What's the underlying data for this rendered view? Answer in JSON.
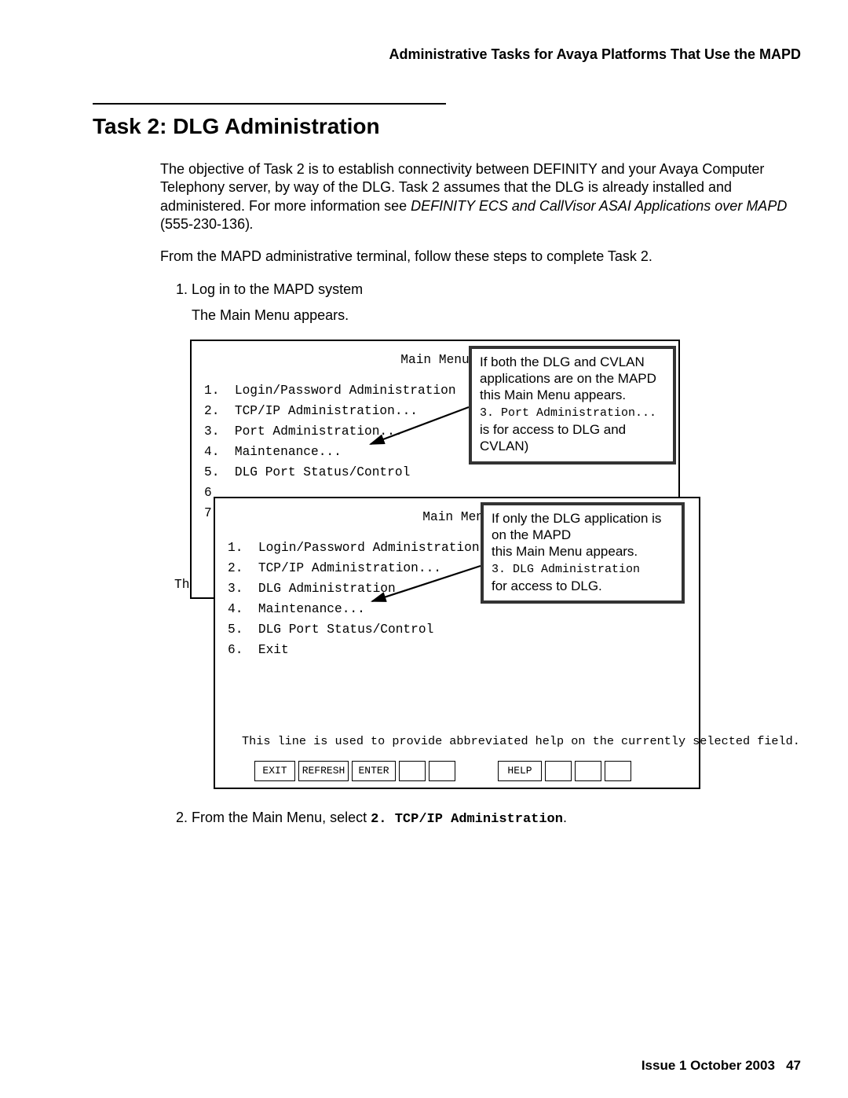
{
  "header": "Administrative Tasks for Avaya Platforms That Use the MAPD",
  "title": "Task 2: DLG Administration",
  "intro": {
    "p1a": "The objective of Task 2 is to establish connectivity between DEFINITY and your Avaya Computer Telephony server, by way of the DLG. Task 2 assumes that the DLG is already installed and administered. For more information see ",
    "p1b": "DEFINITY ECS and CallVisor ASAI Applications over MAPD",
    "p1c": " (555-230-136)",
    "p1d": ".",
    "p2": "From the MAPD administrative terminal, follow these steps to complete Task 2."
  },
  "steps": {
    "s1": "Log in to the MAPD system",
    "s1b": "The Main Menu appears.",
    "s2a": "From the Main Menu, select ",
    "s2b": "2. TCP/IP Administration",
    "s2c": "."
  },
  "screen_shared": {
    "menu_title": "Main Menu"
  },
  "screen1": {
    "i1": "1.  Login/Password Administration",
    "i2": "2.  TCP/IP Administration...",
    "i3": "3.  Port Administration...",
    "i4": "4.  Maintenance...",
    "i5": "5.  DLG Port Status/Control",
    "i6": "6",
    "i7": "7",
    "th": "Th"
  },
  "screen2": {
    "i1": "1.  Login/Password Administration",
    "i2": "2.  TCP/IP Administration...",
    "i3": "3.  DLG Administration",
    "i4": "4.  Maintenance...",
    "i5": "5.  DLG Port Status/Control",
    "i6": "6.  Exit",
    "help": "This line is used to provide abbreviated help on the currently selected field."
  },
  "buttons": {
    "b1": "EXIT",
    "b2": "REFRESH",
    "b3": "ENTER",
    "b4": "",
    "b5": "",
    "b6": "HELP",
    "b7": "",
    "b8": "",
    "b9": ""
  },
  "callout1": {
    "l1": "If both the DLG and CVLAN applications are on the MAPD this Main Menu appears.",
    "l2a": "3.  Port Administration...",
    "l2b": " is for access to DLG and CVLAN)"
  },
  "callout2": {
    "l1": "If only the DLG application is on the MAPD",
    "l1b": "this Main Menu appears.",
    "l2a": "3.  DLG Administration",
    "l2b": "for access to DLG."
  },
  "footer": {
    "issue": "Issue 1   October 2003",
    "page": "47"
  }
}
